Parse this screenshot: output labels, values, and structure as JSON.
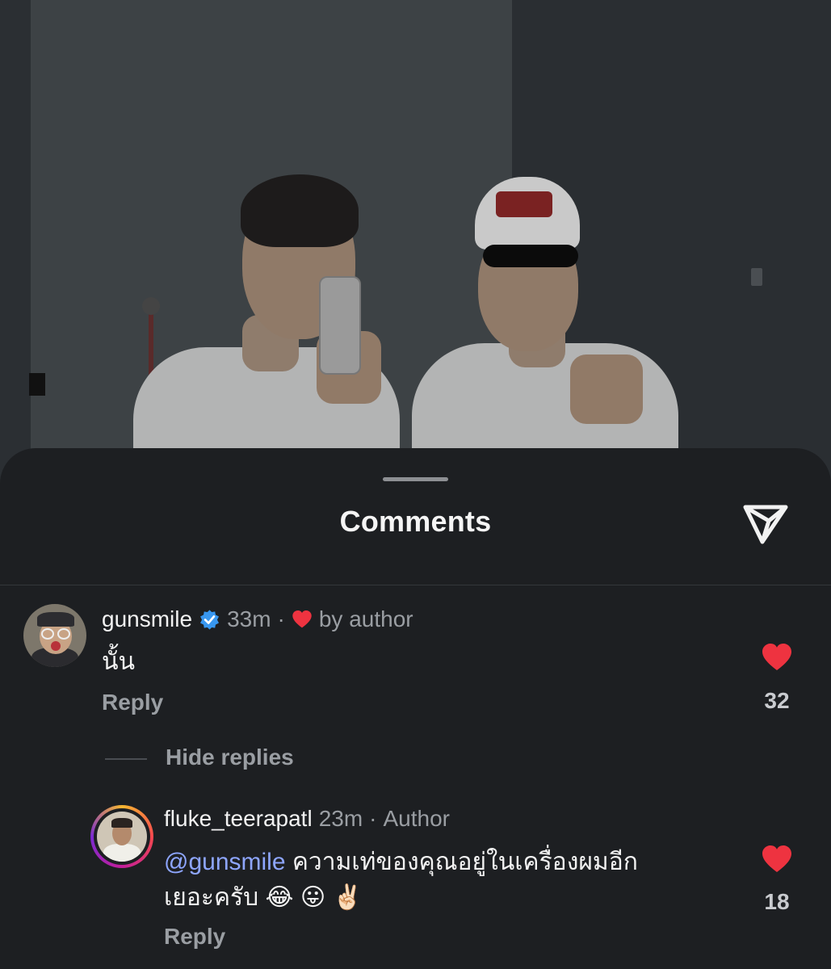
{
  "sheet": {
    "title": "Comments",
    "share_icon": "paper-plane-icon"
  },
  "comments": [
    {
      "username": "gunsmile",
      "verified": true,
      "time": "33m",
      "separator": "·",
      "liked_by_author_label": "by author",
      "text": "นั้น",
      "reply_label": "Reply",
      "like_count": "32",
      "liked": true
    }
  ],
  "replies_toggle": {
    "label": "Hide replies"
  },
  "replies": [
    {
      "username": "fluke_teerapatl",
      "time": "23m",
      "separator": "·",
      "author_label": "Author",
      "mention": "@gunsmile",
      "text_line1": "ความเท่ของคุณอยู่ในเครื่องผมอีก",
      "text_line2": "เยอะครับ 😂 😛 ✌🏻",
      "reply_label": "Reply",
      "like_count": "18",
      "liked": true
    }
  ],
  "colors": {
    "heart": "#ee3340",
    "verified": "#3897f0",
    "mention": "#8ea6ff",
    "sheet_bg": "#1d1f22"
  }
}
